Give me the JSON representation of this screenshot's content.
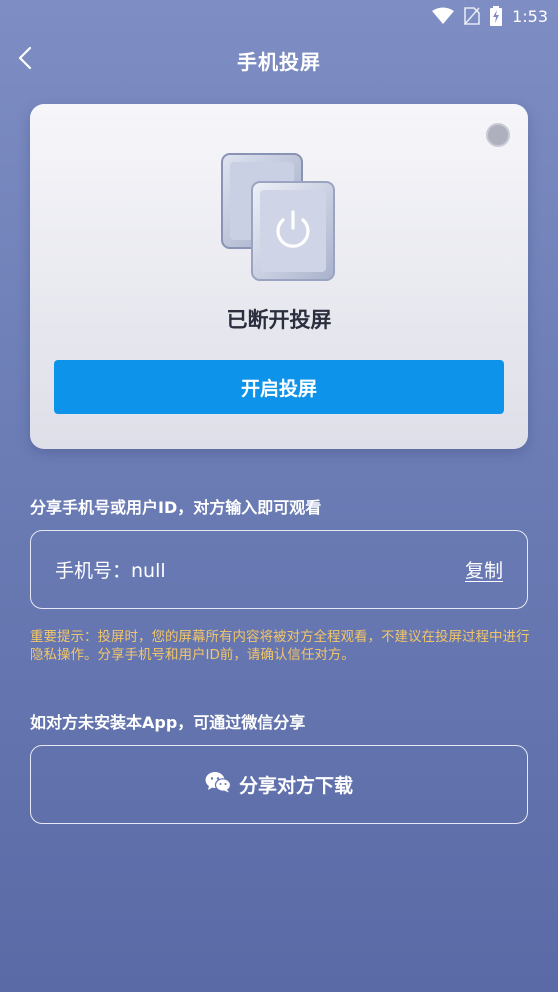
{
  "status_bar": {
    "time": "1:53",
    "icons": [
      "wifi-icon",
      "no-sim-icon",
      "battery-charging-icon"
    ]
  },
  "header": {
    "title": "手机投屏",
    "back_icon": "chevron-left-icon"
  },
  "card": {
    "status_text": "已断开投屏",
    "start_button_label": "开启投屏",
    "device_icon": "screen-cast-power-icon",
    "accent_color": "#0e93ea"
  },
  "share_id": {
    "label": "分享手机号或用户ID，对方输入即可观看",
    "phone_label": "手机号：",
    "phone_value": "null",
    "copy_label": "复制"
  },
  "warning": {
    "text": "重要提示：投屏时，您的屏幕所有内容将被对方全程观看，不建议在投屏过程中进行隐私操作。分享手机号和用户ID前，请确认信任对方。",
    "color": "#f2c66a"
  },
  "share_download": {
    "label": "如对方未安装本App，可通过微信分享",
    "button_label": "分享对方下载",
    "button_icon": "wechat-icon"
  }
}
